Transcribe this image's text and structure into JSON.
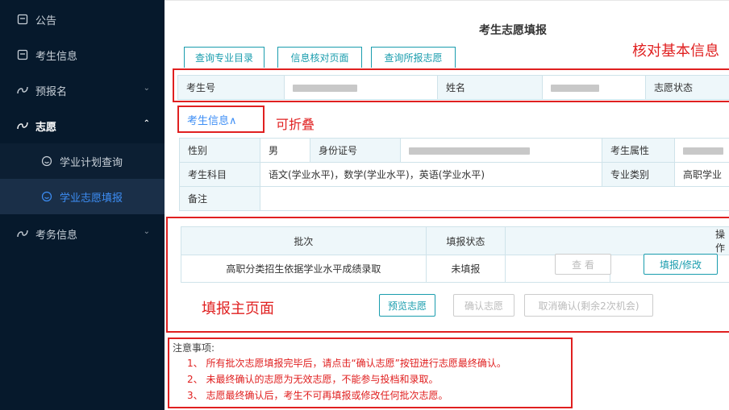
{
  "sidebar": {
    "items": [
      {
        "label": "公告"
      },
      {
        "label": "考生信息"
      },
      {
        "label": "预报名"
      },
      {
        "label": "志愿"
      },
      {
        "label": "学业计划查询"
      },
      {
        "label": "学业志愿填报"
      },
      {
        "label": "考务信息"
      }
    ]
  },
  "page": {
    "title": "考生志愿填报",
    "tabs": [
      "查询专业目录",
      "信息核对页面",
      "查询所报志愿"
    ]
  },
  "annotations": {
    "verify": "核对基本信息",
    "collapsible": "可折叠",
    "main_page": "填报主页面"
  },
  "basic_info": {
    "exam_no_label": "考生号",
    "name_label": "姓名",
    "status_label": "志愿状态"
  },
  "student_info": {
    "toggle_label": "考生信息∧",
    "gender_label": "性别",
    "gender_value": "男",
    "id_label": "身份证号",
    "attr_label": "考生属性",
    "subjects_label": "考生科目",
    "subjects_value": "语文(学业水平)，数学(学业水平)，英语(学业水平)",
    "major_type_label": "专业类别",
    "major_type_value": "高职学业",
    "remark_label": "备注"
  },
  "batch_table": {
    "headers": [
      "批次",
      "填报状态",
      "操作"
    ],
    "row": {
      "batch": "高职分类招生依据学业水平成绩录取",
      "status": "未填报",
      "view_label": "查 看",
      "edit_label": "填报/修改"
    }
  },
  "actions": {
    "preview": "预览志愿",
    "confirm": "确认志愿",
    "cancel": "取消确认(剩余2次机会)"
  },
  "notes": {
    "heading": "注意事项:",
    "lines": [
      "1、 所有批次志愿填报完毕后，请点击“确认志愿”按钮进行志愿最终确认。",
      "2、 未最终确认的志愿为无效志愿，不能参与投档和录取。",
      "3、 志愿最终确认后，考生不可再填报或修改任何批次志愿。"
    ]
  },
  "colors": {
    "sidebar_bg": "#06192c",
    "accent": "#1a9dae",
    "annotation_red": "#e02020",
    "active_link": "#3d8ef5"
  }
}
